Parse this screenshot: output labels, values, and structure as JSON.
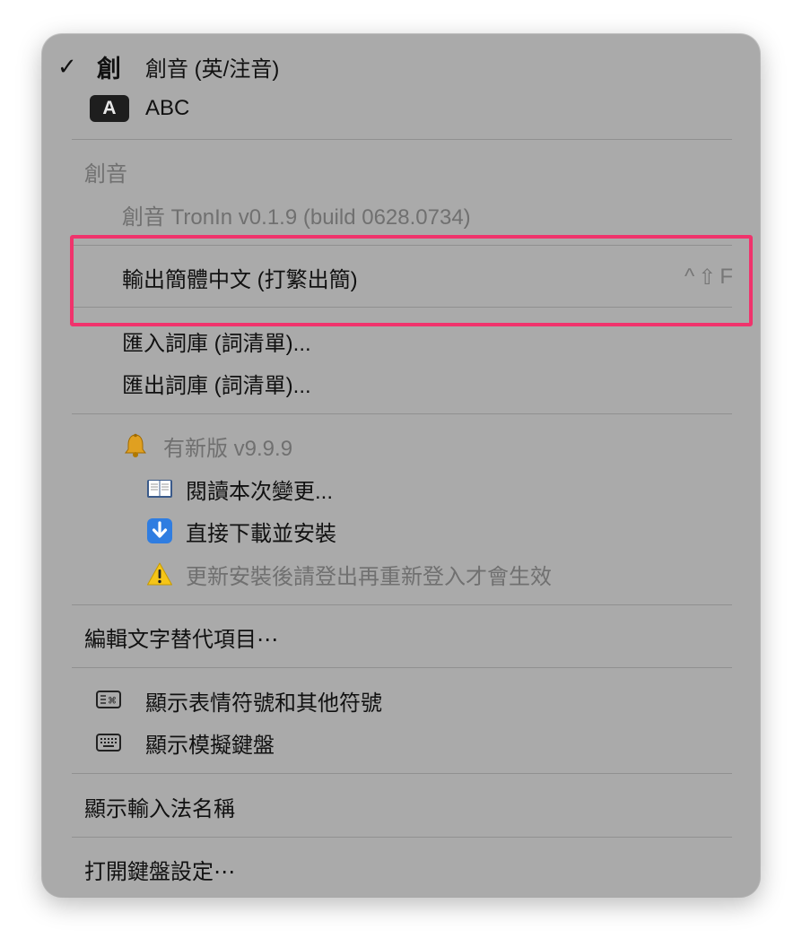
{
  "menu": {
    "input_sources": {
      "chuang": {
        "glyph": "創",
        "label": "創音 (英/注音)",
        "checked": true
      },
      "abc": {
        "badge": "A",
        "label": "ABC"
      }
    },
    "section_title": "創音",
    "version_line": "創音 TronIn v0.1.9 (build 0628.0734)",
    "output_simplified": {
      "label": "輸出簡體中文 (打繁出簡)",
      "shortcut": [
        "^",
        "⇧",
        "F"
      ]
    },
    "import_dict": "匯入詞庫 (詞清單)...",
    "export_dict": "匯出詞庫 (詞清單)...",
    "update": {
      "title": "有新版 v9.9.9",
      "read_changes": "閱讀本次變更...",
      "download_install": "直接下載並安裝",
      "warning": "更新安裝後請登出再重新登入才會生效"
    },
    "edit_text_replacements": "編輯文字替代項目⋯",
    "show_emoji": "顯示表情符號和其他符號",
    "show_keyboard_viewer": "顯示模擬鍵盤",
    "show_input_source_name": "顯示輸入法名稱",
    "open_keyboard_settings": "打開鍵盤設定⋯"
  },
  "colors": {
    "menu_background": "#aaaaaa",
    "highlight_border": "#f0336c",
    "disabled_text": "#707070"
  }
}
